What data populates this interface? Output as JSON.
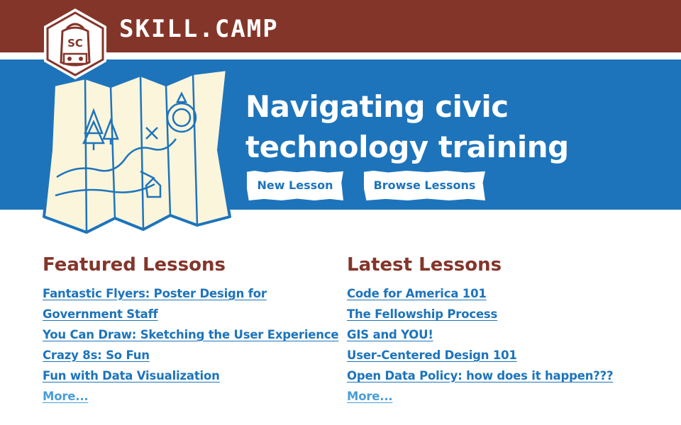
{
  "brand": {
    "name": "SKILL.CAMP",
    "badge_initials": "SC"
  },
  "hero": {
    "title": "Navigating civic technology training",
    "buttons": {
      "new_lesson": "New Lesson",
      "browse_lessons": "Browse Lessons"
    }
  },
  "featured": {
    "heading": "Featured Lessons",
    "items": [
      {
        "label": "Fantastic Flyers: Poster Design for Government Staff"
      },
      {
        "label": "You Can Draw: Sketching the User Experience"
      },
      {
        "label": "Crazy 8s: So Fun"
      },
      {
        "label": "Fun with Data Visualization"
      }
    ],
    "more": "More..."
  },
  "latest": {
    "heading": "Latest Lessons",
    "items": [
      {
        "label": "Code for America 101"
      },
      {
        "label": "The Fellowship Process"
      },
      {
        "label": "GIS and YOU!"
      },
      {
        "label": "User-Centered Design 101"
      },
      {
        "label": "Open Data Policy: how does it happen???"
      }
    ],
    "more": "More..."
  },
  "colors": {
    "brand_red": "#84352a",
    "hero_blue": "#1d74bb",
    "link_blue": "#1d74bb",
    "more_blue": "#4a9ed8",
    "map_paper": "#fbf5dc"
  },
  "icons": {
    "logo": "backpack-badge-icon",
    "hero_art": "folded-map-illustration"
  }
}
